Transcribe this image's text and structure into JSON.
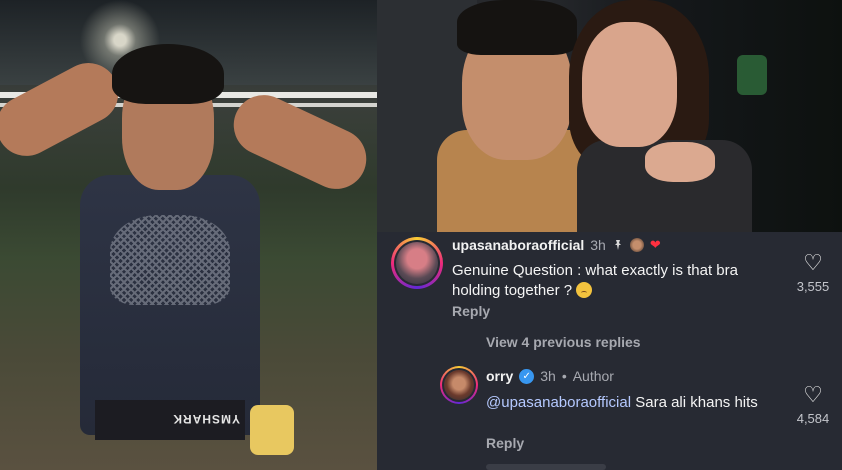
{
  "left_photo": {
    "waistband_text": "YMSHARK"
  },
  "comment1": {
    "username": "upasanaboraofficial",
    "time": "3h",
    "icons": {
      "pin": "pin-icon",
      "liked_by_author": "heart-icon"
    },
    "text": "Genuine Question : what exactly is that bra holding together ?",
    "emoji": "pleading-face-emoji",
    "reply_label": "Reply",
    "like_count": "3,555"
  },
  "view_replies_label": "View 4 previous replies",
  "comment2": {
    "username": "orry",
    "time": "3h",
    "separator": "•",
    "author_label": "Author",
    "mention": "@upasanaboraofficial",
    "text": "Sara ali khans hits",
    "reply_label": "Reply",
    "like_count": "4,584"
  },
  "colors": {
    "panel_bg": "#272a33",
    "mention": "#b5c9ff",
    "verified": "#3897f0",
    "heart_red": "#ff3040"
  }
}
